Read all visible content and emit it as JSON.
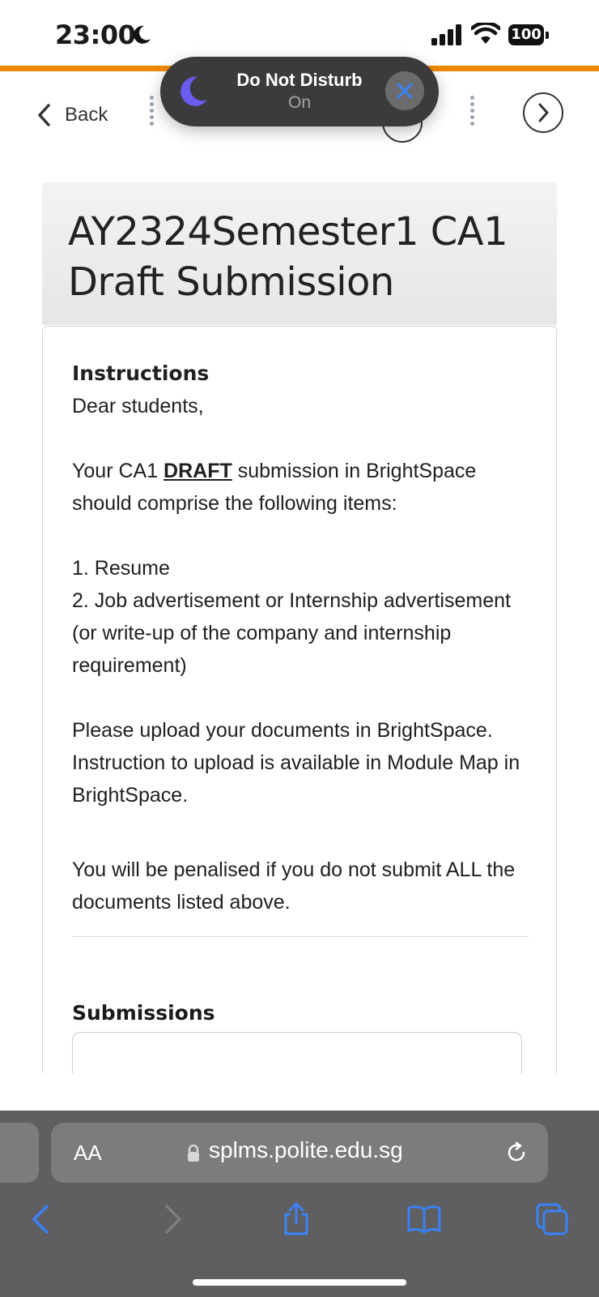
{
  "status": {
    "time": "23:00",
    "battery": "100"
  },
  "nav": {
    "back_label": "Back"
  },
  "dnd": {
    "title": "Do Not Disturb",
    "state": "On"
  },
  "page": {
    "title": "AY2324Semester1 CA1 Draft Submission",
    "instructions_heading": "Instructions",
    "greeting": "Dear students,",
    "para1_before": "Your CA1 ",
    "para1_emph": "DRAFT",
    "para1_after": " submission in BrightSpace should comprise the following items:",
    "item1": "1. Resume",
    "item2": "2. Job advertisement or Internship advertisement (or write-up of the company and internship requirement)",
    "para2": "Please upload your documents in BrightSpace. Instruction to upload is available in Module Map in BrightSpace.",
    "para3": "You will be penalised if you do not submit ALL the documents listed above.",
    "submissions_heading": "Submissions"
  },
  "safari": {
    "aa_label": "AA",
    "url": "splms.polite.edu.sg"
  },
  "colors": {
    "accent_orange": "#f08a00",
    "safari_blue": "#3a82f7"
  }
}
